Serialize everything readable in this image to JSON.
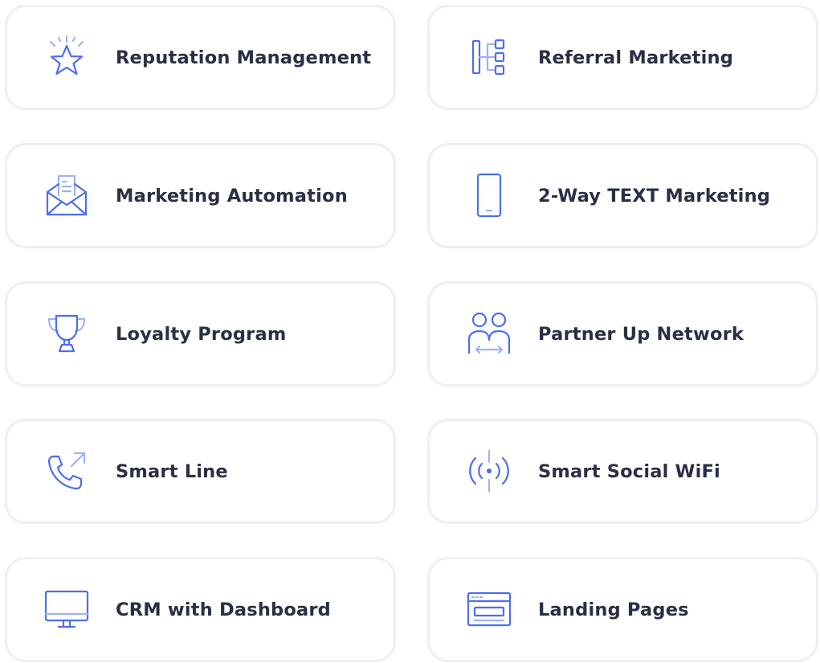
{
  "accent_color": "#4c6ef0",
  "accent_light_color": "#9fb2f6",
  "text_color": "#2a2f45",
  "cards": [
    {
      "label": "Reputation Management",
      "icon": "star-icon"
    },
    {
      "label": "Referral Marketing",
      "icon": "referral-tree-icon"
    },
    {
      "label": "Marketing Automation",
      "icon": "envelope-letter-icon"
    },
    {
      "label": "2-Way TEXT Marketing",
      "icon": "smartphone-icon"
    },
    {
      "label": "Loyalty Program",
      "icon": "trophy-icon"
    },
    {
      "label": "Partner Up Network",
      "icon": "partners-icon"
    },
    {
      "label": "Smart Line",
      "icon": "phone-outgoing-icon"
    },
    {
      "label": "Smart Social WiFi",
      "icon": "wifi-broadcast-icon"
    },
    {
      "label": "CRM with Dashboard",
      "icon": "monitor-icon"
    },
    {
      "label": "Landing Pages",
      "icon": "browser-window-icon"
    }
  ]
}
